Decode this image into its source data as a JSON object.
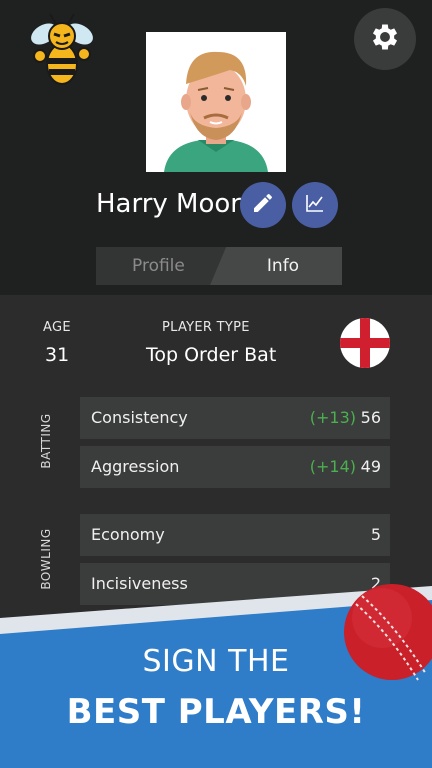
{
  "player": {
    "name": "Harry Moore",
    "age_label": "AGE",
    "age": "31",
    "type_label": "PLAYER TYPE",
    "type": "Top Order Bat",
    "country_flag": "england-flag"
  },
  "tabs": [
    {
      "label": "Profile",
      "active": false
    },
    {
      "label": "Info",
      "active": true
    }
  ],
  "batting": {
    "section_label": "BATTING",
    "attributes": [
      {
        "name": "Consistency",
        "bonus": "(+13)",
        "value": "56"
      },
      {
        "name": "Aggression",
        "bonus": "(+14)",
        "value": "49"
      }
    ]
  },
  "bowling": {
    "section_label": "BOWLING",
    "attributes": [
      {
        "name": "Economy",
        "bonus": "",
        "value": "5"
      },
      {
        "name": "Incisiveness",
        "bonus": "",
        "value": "2"
      }
    ]
  },
  "banner": {
    "line1": "SIGN THE",
    "line2": "BEST PLAYERS!"
  },
  "icons": {
    "settings": "gear-icon",
    "edit": "pencil-icon",
    "stats": "line-chart-icon",
    "logo": "bee-mascot-icon",
    "ball": "cricket-ball-icon"
  },
  "colors": {
    "accent_button": "#4a5fa3",
    "bonus_green": "#4caf50",
    "banner_blue": "#2f7cc9",
    "ball_red": "#c9202a"
  }
}
